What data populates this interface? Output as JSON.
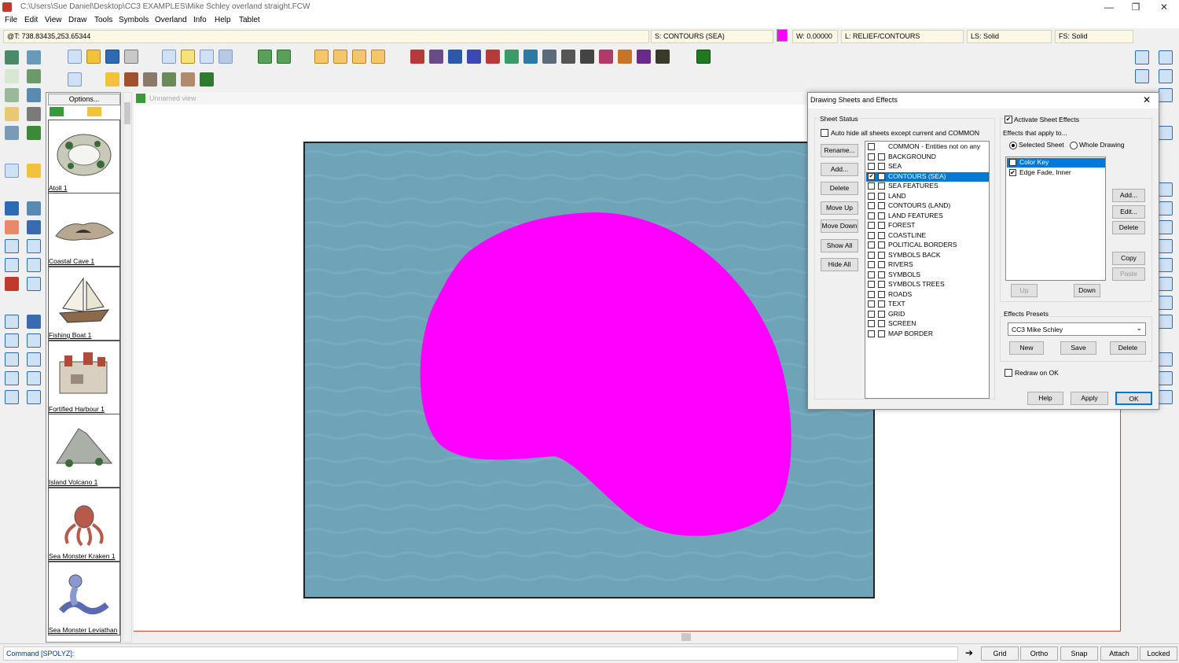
{
  "window": {
    "title": "C:\\Users\\Sue Daniel\\Desktop\\CC3 EXAMPLES\\Mike Schley overland straight.FCW",
    "min": "—",
    "max": "❐",
    "close": "✕"
  },
  "menu": [
    "File",
    "Edit",
    "View",
    "Draw",
    "Tools",
    "Symbols",
    "Overland",
    "Info",
    "Help",
    "Tablet"
  ],
  "status": {
    "coords": "@T: 738.83435,253.65344",
    "sheet": "S: CONTOURS (SEA)",
    "color": "#ff00ff",
    "width": "W: 0.00000",
    "layer": "L: RELIEF/CONTOURS",
    "line_style": "LS: Solid",
    "fill_style": "FS: Solid"
  },
  "symbols_panel": {
    "options_label": "Options...",
    "items": [
      {
        "label": "Atoll 1"
      },
      {
        "label": "Coastal Cave 1"
      },
      {
        "label": "Fishing Boat 1"
      },
      {
        "label": "Fortified Harbour 1"
      },
      {
        "label": "Island Volcano 1"
      },
      {
        "label": "Sea Monster Kraken 1"
      },
      {
        "label": "Sea Monster Leviathan"
      }
    ]
  },
  "view": {
    "title": "Unnamed view",
    "shape_color": "#ff00ff",
    "water_color": "#6fa3b8"
  },
  "dialog": {
    "title": "Drawing Sheets and Effects",
    "sheet_status_label": "Sheet Status",
    "auto_hide_label": "Auto hide all sheets except current and COMMON",
    "buttons_left": [
      "Rename...",
      "Add...",
      "Delete",
      "Move Up",
      "Move Down",
      "Show All",
      "Hide All"
    ],
    "sheets": [
      {
        "name": "COMMON - Entities not on any",
        "c1": false,
        "c2": null,
        "selected": false
      },
      {
        "name": "BACKGROUND",
        "c1": false,
        "c2": false,
        "selected": false
      },
      {
        "name": "SEA",
        "c1": false,
        "c2": false,
        "selected": false
      },
      {
        "name": "CONTOURS (SEA)",
        "c1": true,
        "c2": false,
        "selected": true
      },
      {
        "name": "SEA FEATURES",
        "c1": false,
        "c2": false,
        "selected": false
      },
      {
        "name": "LAND",
        "c1": false,
        "c2": false,
        "selected": false
      },
      {
        "name": "CONTOURS (LAND)",
        "c1": false,
        "c2": false,
        "selected": false
      },
      {
        "name": "LAND FEATURES",
        "c1": false,
        "c2": false,
        "selected": false
      },
      {
        "name": "FOREST",
        "c1": false,
        "c2": false,
        "selected": false
      },
      {
        "name": "COASTLINE",
        "c1": false,
        "c2": false,
        "selected": false
      },
      {
        "name": "POLITICAL BORDERS",
        "c1": false,
        "c2": false,
        "selected": false
      },
      {
        "name": "SYMBOLS BACK",
        "c1": false,
        "c2": false,
        "selected": false
      },
      {
        "name": "RIVERS",
        "c1": false,
        "c2": false,
        "selected": false
      },
      {
        "name": "SYMBOLS",
        "c1": false,
        "c2": false,
        "selected": false
      },
      {
        "name": "SYMBOLS TREES",
        "c1": false,
        "c2": false,
        "selected": false
      },
      {
        "name": "ROADS",
        "c1": false,
        "c2": false,
        "selected": false
      },
      {
        "name": "TEXT",
        "c1": false,
        "c2": false,
        "selected": false
      },
      {
        "name": "GRID",
        "c1": false,
        "c2": false,
        "selected": false
      },
      {
        "name": "SCREEN",
        "c1": false,
        "c2": false,
        "selected": false
      },
      {
        "name": "MAP BORDER",
        "c1": false,
        "c2": false,
        "selected": false
      }
    ],
    "activate_label": "Activate Sheet Effects",
    "activate_checked": true,
    "effects_apply_label": "Effects that apply to...",
    "radio_selected_sheet": "Selected Sheet",
    "radio_whole_drawing": "Whole Drawing",
    "effects": [
      {
        "name": "Color Key",
        "checked": false,
        "selected": true
      },
      {
        "name": "Edge Fade, Inner",
        "checked": true,
        "selected": false
      }
    ],
    "effects_buttons": [
      "Add...",
      "Edit...",
      "Delete",
      "Copy",
      "Paste"
    ],
    "up_label": "Up",
    "down_label": "Down",
    "presets_label": "Effects Presets",
    "preset_value": "CC3 Mike Schley",
    "preset_buttons": [
      "New",
      "Save",
      "Delete"
    ],
    "redraw_label": "Redraw on OK",
    "footer_buttons": [
      "Help",
      "Apply",
      "OK"
    ],
    "close": "✕"
  },
  "command_line": "Command [SPOLYZ]:",
  "bottom_buttons": [
    "Grid",
    "Ortho",
    "Snap",
    "Attach",
    "Locked"
  ]
}
